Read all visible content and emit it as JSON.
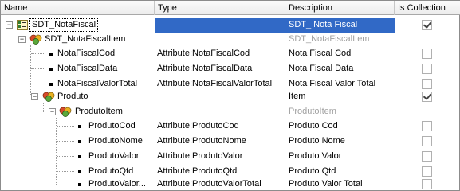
{
  "columns": {
    "name": "Name",
    "type": "Type",
    "description": "Description",
    "collection": "Is Collection"
  },
  "rows": [
    {
      "name": "SDT_NotaFiscal",
      "type": "",
      "description": "SDT_ Nota Fiscal",
      "collection": true,
      "kind": "sdt",
      "selected": true
    },
    {
      "name": "SDT_NotaFiscalItem",
      "type": "",
      "description": "SDT_NotaFiscalItem",
      "collection": false,
      "kind": "group",
      "grey_desc": true
    },
    {
      "name": "NotaFiscalCod",
      "type": "Attribute:NotaFiscalCod",
      "description": "Nota Fiscal Cod",
      "collection": false,
      "kind": "attr"
    },
    {
      "name": "NotaFiscalData",
      "type": "Attribute:NotaFiscalData",
      "description": "Nota Fiscal Data",
      "collection": false,
      "kind": "attr"
    },
    {
      "name": "NotaFiscalValorTotal",
      "type": "Attribute:NotaFiscalValorTotal",
      "description": "Nota Fiscal Valor Total",
      "collection": false,
      "kind": "attr"
    },
    {
      "name": "Produto",
      "type": "",
      "description": "Item",
      "collection": true,
      "kind": "group"
    },
    {
      "name": "ProdutoItem",
      "type": "",
      "description": "ProdutoItem",
      "collection": false,
      "kind": "group",
      "grey_desc": true,
      "no_check": true
    },
    {
      "name": "ProdutoCod",
      "type": "Attribute:ProdutoCod",
      "description": "Produto Cod",
      "collection": false,
      "kind": "attr"
    },
    {
      "name": "ProdutoNome",
      "type": "Attribute:ProdutoNome",
      "description": "Produto Nome",
      "collection": false,
      "kind": "attr"
    },
    {
      "name": "ProdutoValor",
      "type": "Attribute:ProdutoValor",
      "description": "Produto Valor",
      "collection": false,
      "kind": "attr"
    },
    {
      "name": "ProdutoQtd",
      "type": "Attribute:ProdutoQtd",
      "description": "Produto Qtd",
      "collection": false,
      "kind": "attr"
    },
    {
      "name": "ProdutoValor...",
      "type": "Attribute:ProdutoValorTotal",
      "description": "Produto Valor Total",
      "collection": false,
      "kind": "attr"
    }
  ],
  "colors": {
    "selection": "#3169c6",
    "header_bg": "#ececec",
    "grey_text": "#a0a0a0"
  },
  "icons": {
    "sdt": "sdt-structure-icon",
    "group": "group-level-icon",
    "attr": "bullet-icon",
    "expand": "collapse-minus-icon"
  }
}
